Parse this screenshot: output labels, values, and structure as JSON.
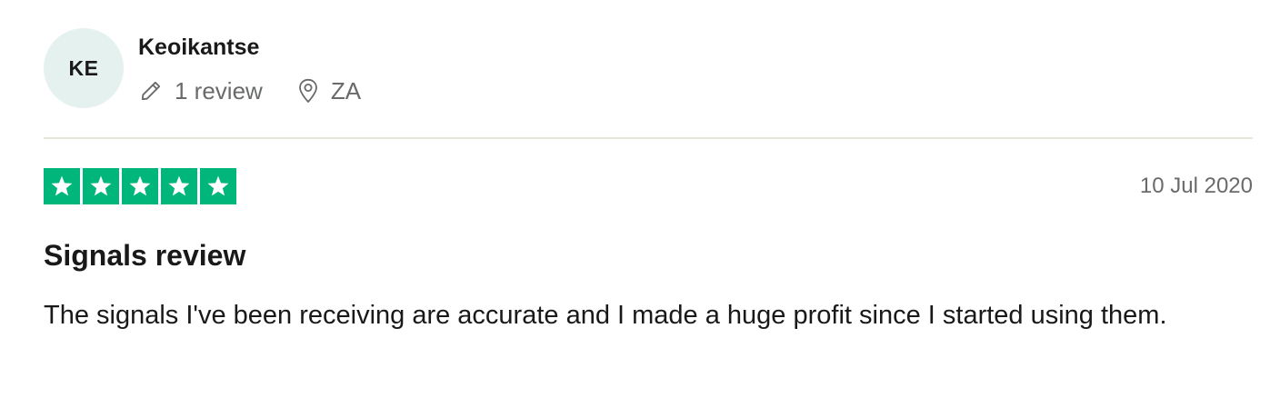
{
  "reviewer": {
    "initials": "KE",
    "name": "Keoikantse",
    "review_count": "1 review",
    "country": "ZA",
    "avatar_color": "#e5f1ef"
  },
  "review": {
    "rating": 5,
    "rating_max": 5,
    "star_color": "#00b67a",
    "date": "10 Jul 2020",
    "title": "Signals review",
    "body": "The signals I've been receiving are accurate and I made a huge profit since I started using them."
  },
  "icons": {
    "review_count": "pencil-icon",
    "location": "location-pin-icon",
    "star": "star-icon"
  }
}
